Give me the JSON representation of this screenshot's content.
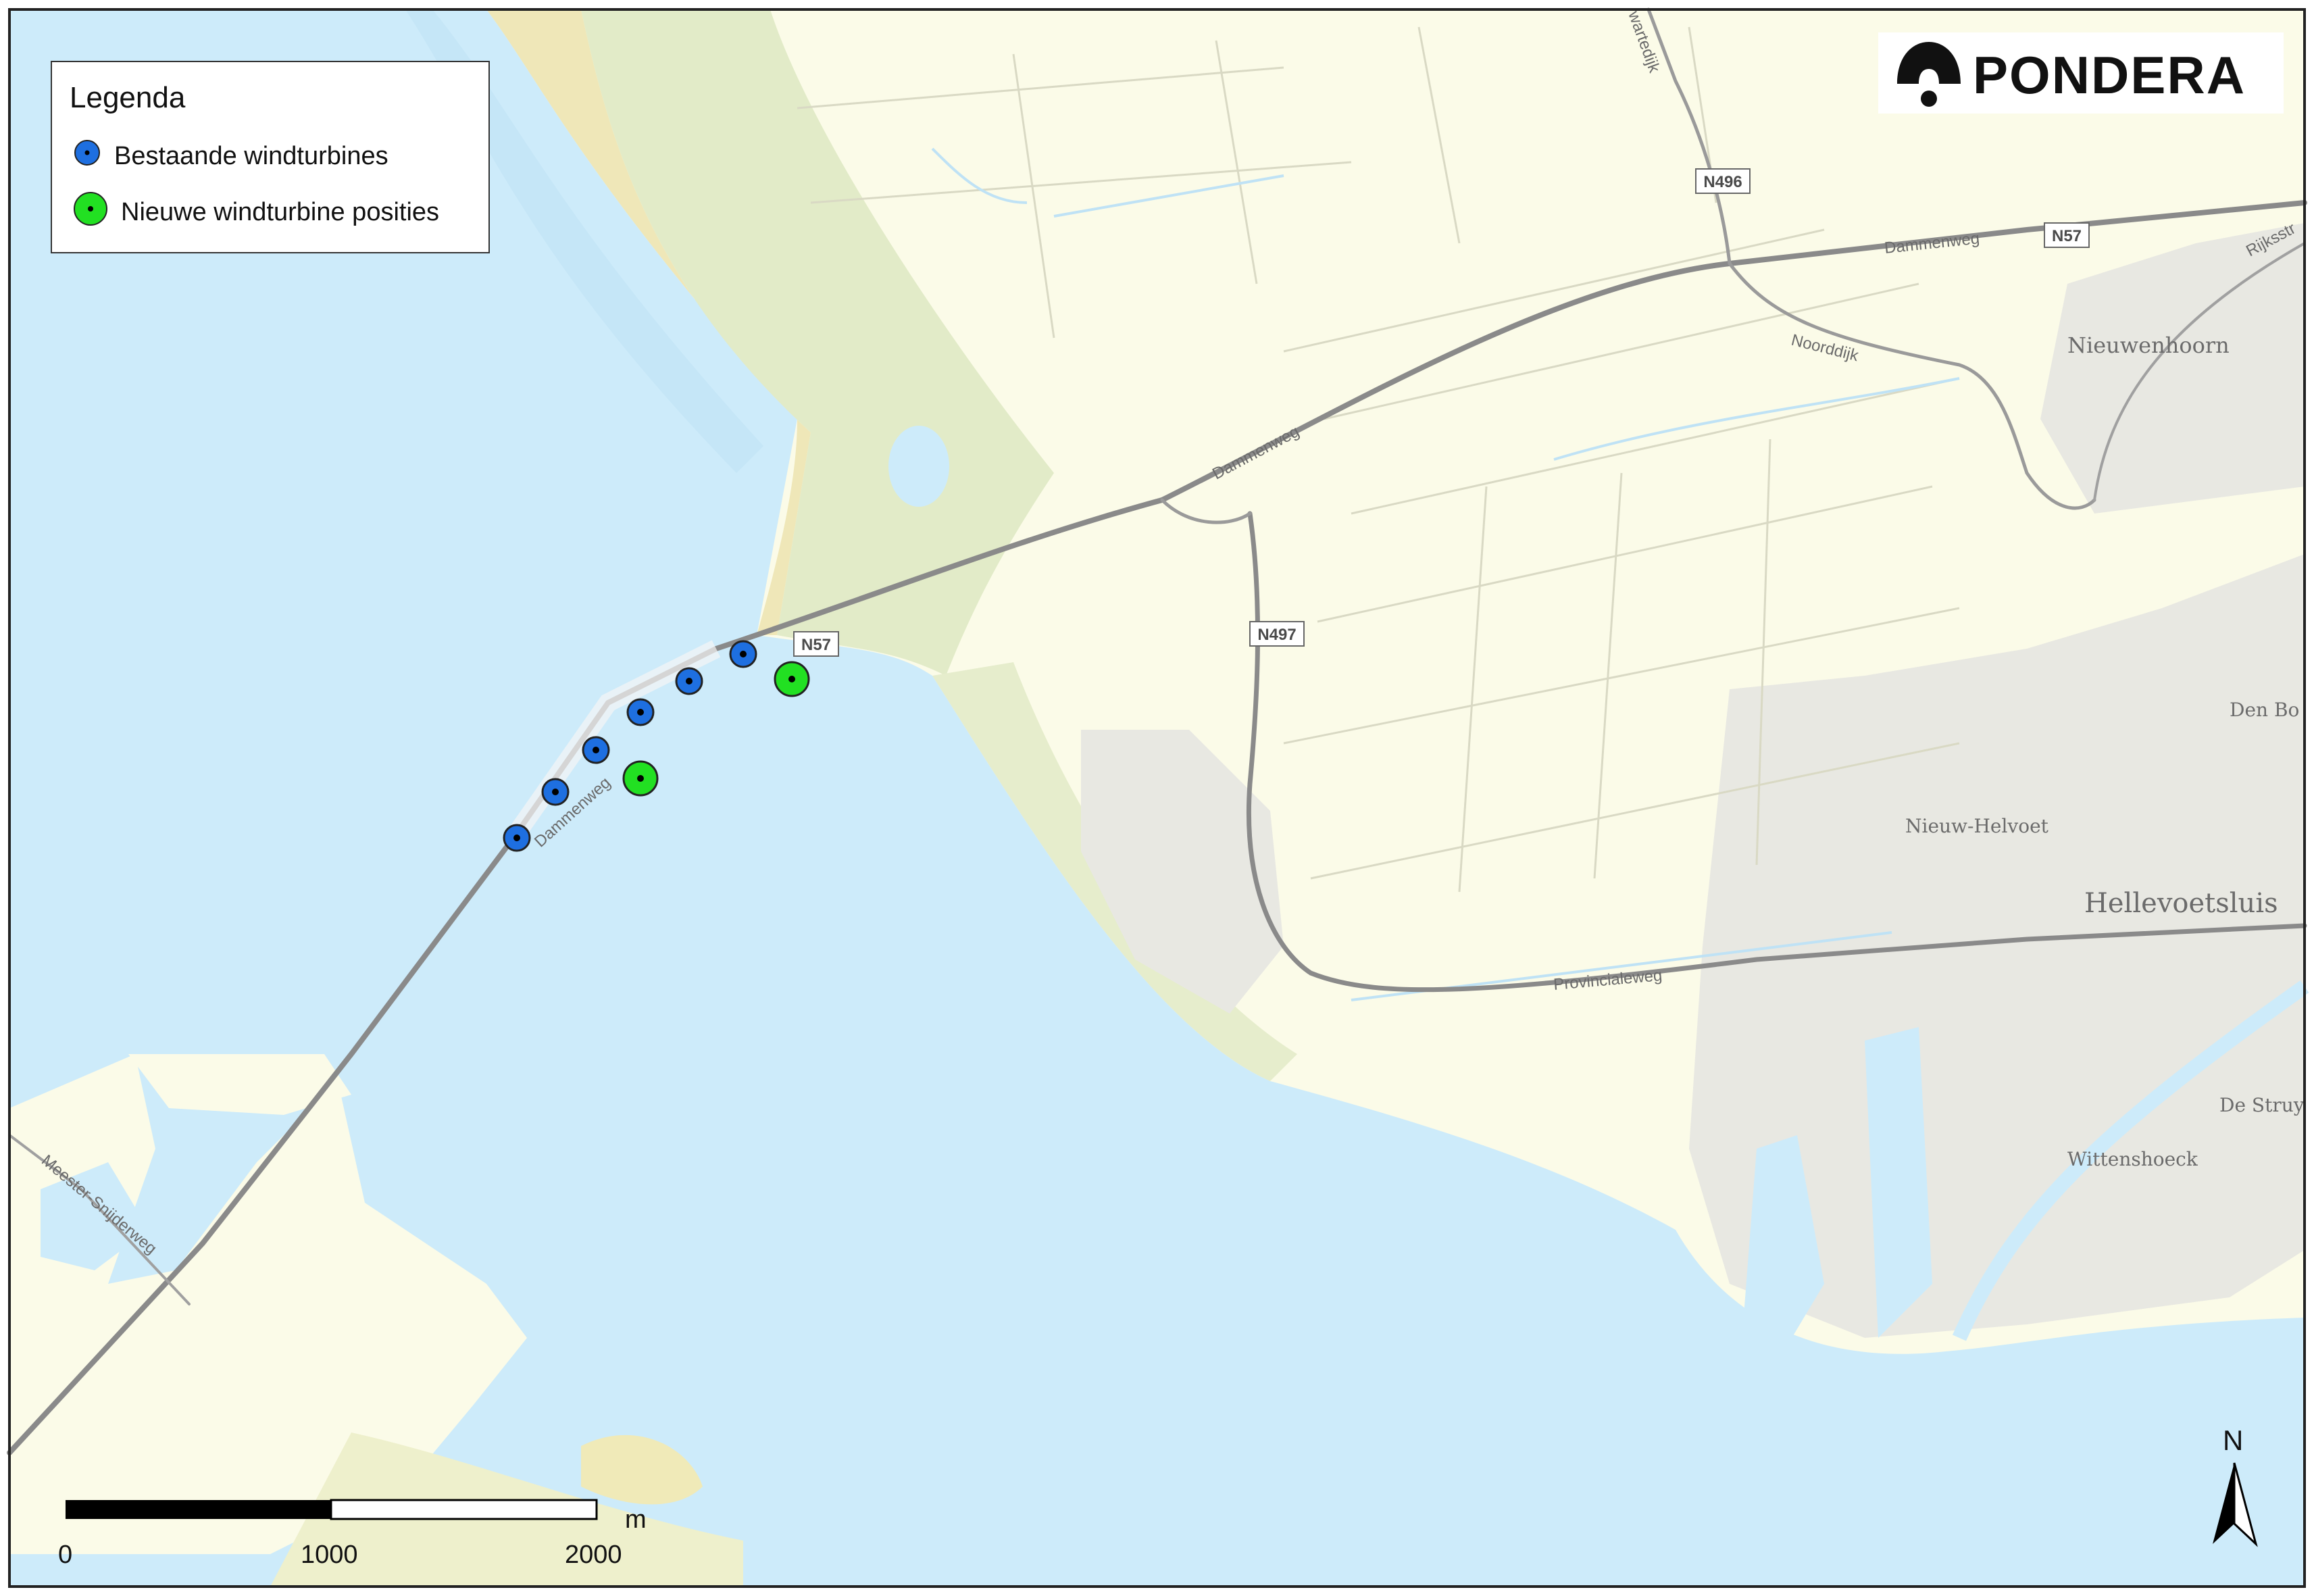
{
  "legend": {
    "title": "Legenda",
    "items": [
      {
        "label": "Bestaande windturbines",
        "color": "#1e6fe0"
      },
      {
        "label": "Nieuwe windturbine posities",
        "color": "#22e022"
      }
    ]
  },
  "logo": {
    "text": "PONDERA"
  },
  "places": {
    "nieuwenhoorn": "Nieuwenhoorn",
    "den_bommel": "Den Bo",
    "nieuw_helvoet": "Nieuw-Helvoet",
    "hellevoetsluis": "Hellevoetsluis",
    "de_struyten": "De Struy",
    "wittenshoeck": "Wittenshoeck"
  },
  "roads": {
    "dammenweg_east": "Dammenweg",
    "dammenweg_mid": "Dammenweg",
    "dammenweg_dam": "Dammenweg",
    "noorddijk": "Noorddijk",
    "provincialeweg": "Provincialeweg",
    "meester_snijderweg": "Meester-Snijderweg",
    "rijksstraat": "Rijksstr",
    "zwartedijk": "wartedijk"
  },
  "shields": {
    "n57_top": "N57",
    "n57_dam": "N57",
    "n496": "N496",
    "n497": "N497"
  },
  "scale": {
    "unit": "m",
    "ticks": [
      "0",
      "1000",
      "2000"
    ]
  },
  "north": "N",
  "colors": {
    "water": "#cdebfa",
    "land": "#fbfbe8",
    "dunes": "#e4ebc9",
    "road": "#8a8a8a",
    "existing_turbine": "#1e6fe0",
    "new_turbine": "#22e022"
  }
}
